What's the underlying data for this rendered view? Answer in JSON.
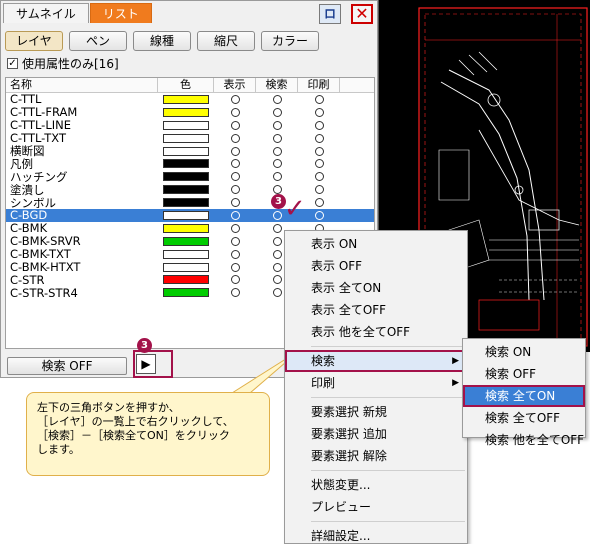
{
  "tabs": [
    "サムネイル",
    "リスト"
  ],
  "window_buttons": {
    "pin": "ロ",
    "close": "✕"
  },
  "filter_buttons": [
    "レイヤ",
    "ペン",
    "線種",
    "縮尺",
    "カラー"
  ],
  "checkbox": {
    "label": "使用属性のみ[16]",
    "checked": true
  },
  "columns": {
    "name": "名称",
    "color": "色",
    "display": "表示",
    "search": "検索",
    "print": "印刷"
  },
  "layers": [
    {
      "name": "C-TTL",
      "color": "#ffff00"
    },
    {
      "name": "C-TTL-FRAM",
      "color": "#ffff00"
    },
    {
      "name": "C-TTL-LINE",
      "color": "#ffffff"
    },
    {
      "name": "C-TTL-TXT",
      "color": "#ffffff"
    },
    {
      "name": "横断図",
      "color": "#ffffff"
    },
    {
      "name": "凡例",
      "color": "#000000"
    },
    {
      "name": "ハッチング",
      "color": "#000000"
    },
    {
      "name": "塗潰し",
      "color": "#000000"
    },
    {
      "name": "シンボル",
      "color": "#000000"
    },
    {
      "name": "C-BGD",
      "color": "#ffffff",
      "selected": true
    },
    {
      "name": "C-BMK",
      "color": "#ffff00"
    },
    {
      "name": "C-BMK-SRVR",
      "color": "#00cc00"
    },
    {
      "name": "C-BMK-TXT",
      "color": "#ffffff"
    },
    {
      "name": "C-BMK-HTXT",
      "color": "#ffffff"
    },
    {
      "name": "C-STR",
      "color": "#ff0000"
    },
    {
      "name": "C-STR-STR4",
      "color": "#00cc00"
    }
  ],
  "bottom": {
    "search_off": "検索 OFF",
    "triangle": "▶"
  },
  "badges": [
    "3",
    "3"
  ],
  "context_menu": [
    {
      "label": "表示 ON"
    },
    {
      "label": "表示 OFF"
    },
    {
      "label": "表示 全てON"
    },
    {
      "label": "表示 全てOFF"
    },
    {
      "label": "表示 他を全てOFF"
    },
    {
      "label": "検索",
      "submenu": true,
      "highlighted": true
    },
    {
      "label": "印刷",
      "submenu": true
    },
    {
      "label": "要素選択 新規"
    },
    {
      "label": "要素選択 追加"
    },
    {
      "label": "要素選択 解除"
    },
    {
      "label": "状態変更..."
    },
    {
      "label": "プレビュー"
    },
    {
      "label": "詳細設定..."
    }
  ],
  "submenu": [
    {
      "label": "検索 ON"
    },
    {
      "label": "検索 OFF"
    },
    {
      "label": "検索 全てON",
      "highlighted": true
    },
    {
      "label": "検索 全てOFF"
    },
    {
      "label": "検索 他を全てOFF"
    }
  ],
  "callout": {
    "lines": [
      "左下の三角ボタンを押すか、",
      "［レイヤ］の一覧上で右クリックして、",
      "［検索］－［検索全てON］をクリック",
      "します。"
    ]
  },
  "colors": {
    "accent": "#a3124a",
    "tab_active": "#f07b1e",
    "selection": "#3a7fd5"
  }
}
